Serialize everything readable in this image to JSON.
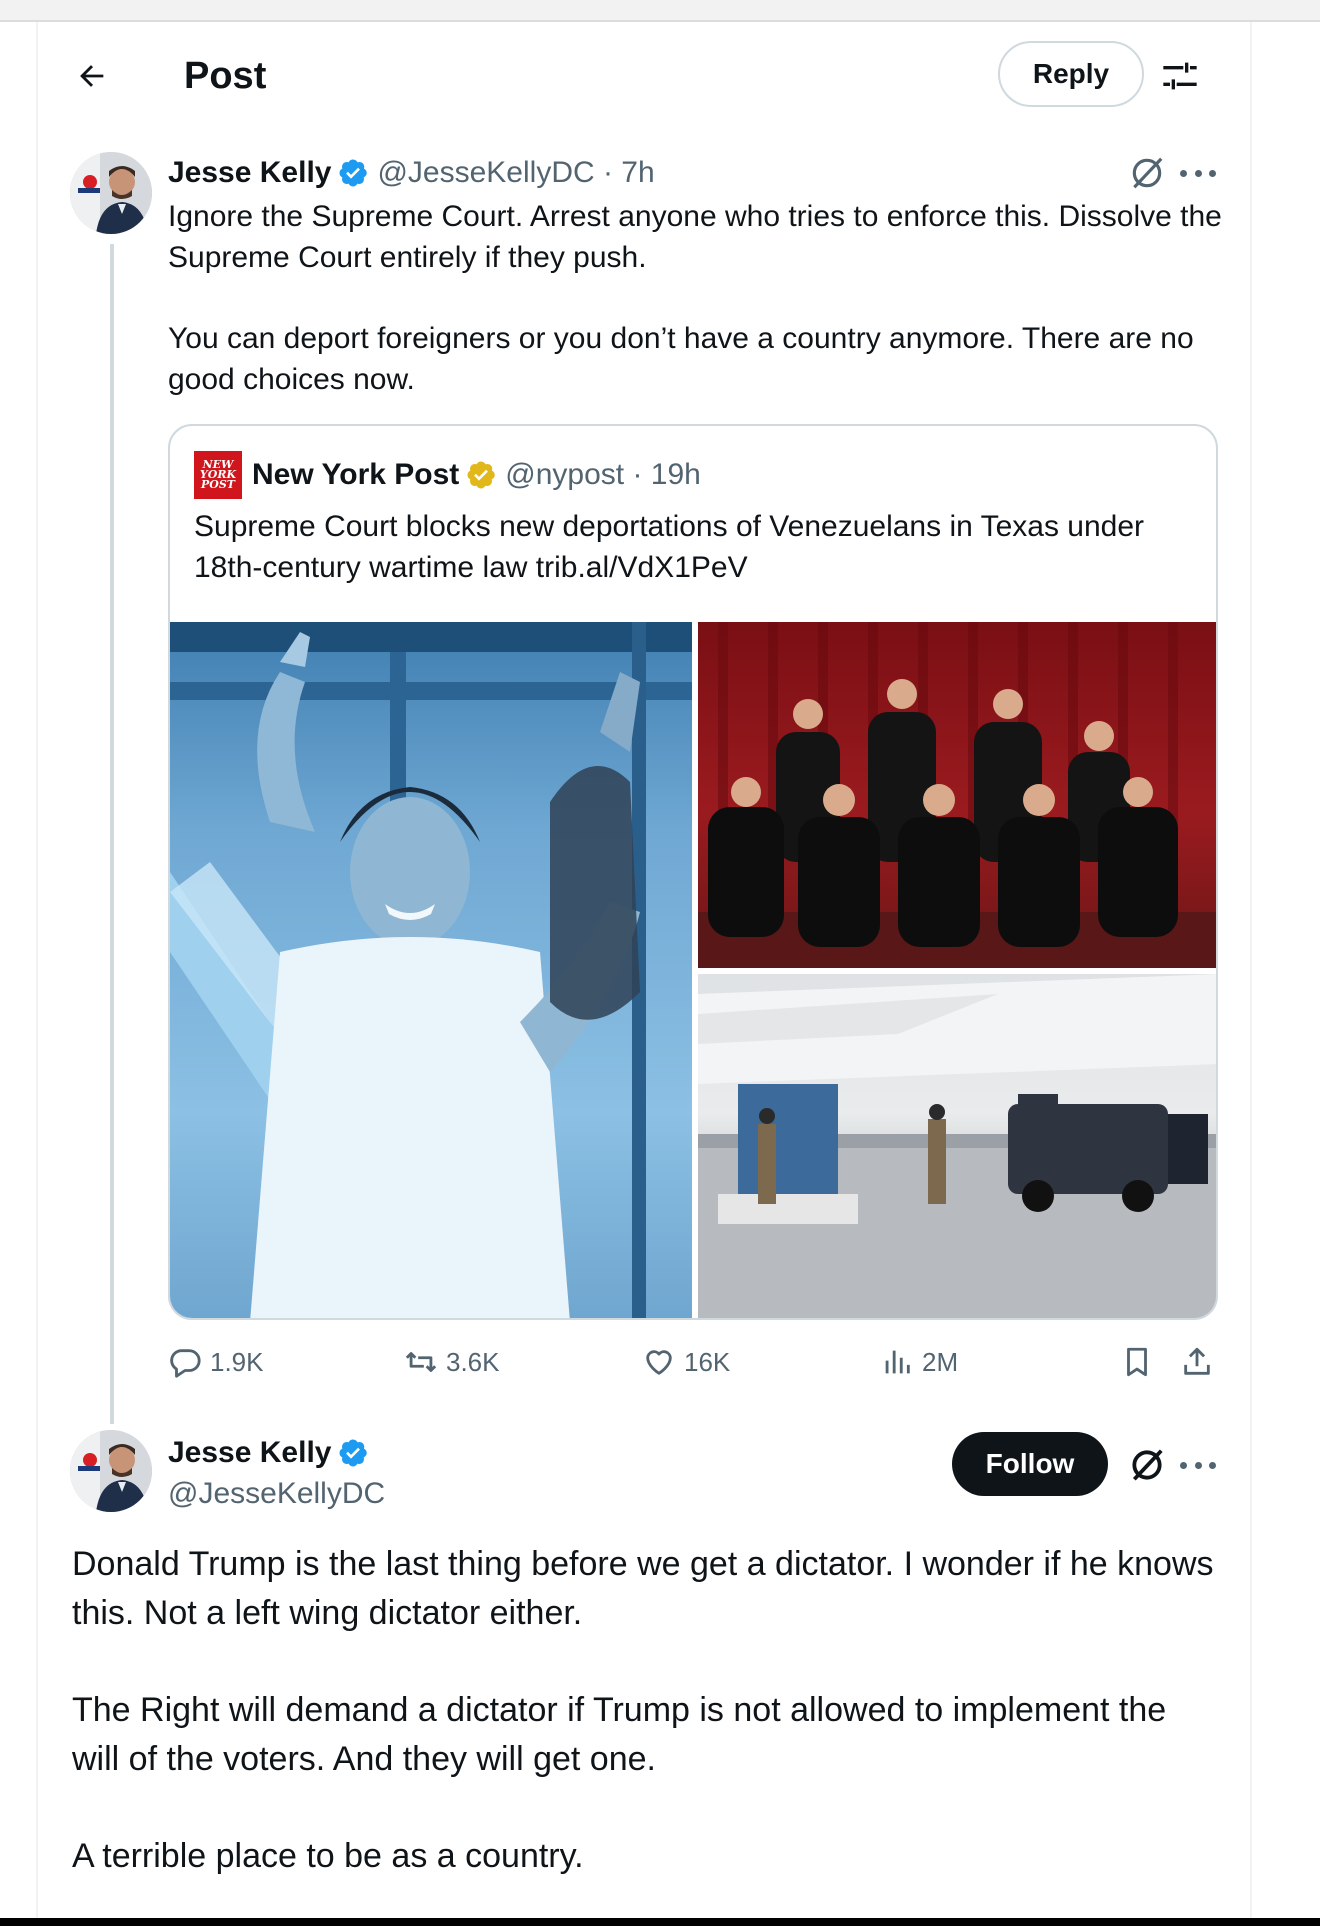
{
  "header": {
    "title": "Post",
    "reply_label": "Reply"
  },
  "tweet1": {
    "name": "Jesse Kelly",
    "handle_time": "@JesseKellyDC · 7h",
    "paragraphs": [
      "Ignore the Supreme Court. Arrest anyone who tries to enforce this. Dissolve the Supreme Court entirely if they push.",
      "You can deport foreigners or you don’t have a country anymore. There are no good choices now."
    ],
    "quote": {
      "logo_text": [
        "NEW",
        "YORK",
        "POST"
      ],
      "name": "New York Post",
      "handle_time": "@nypost · 19h",
      "text": "Supreme Court blocks new deportations of Venezuelans in Texas under 18th-century wartime law trib.al/VdX1PeV"
    },
    "stats": {
      "replies": "1.9K",
      "reposts": "3.6K",
      "likes": "16K",
      "views": "2M"
    }
  },
  "tweet2": {
    "name": "Jesse Kelly",
    "handle": "@JesseKellyDC",
    "follow_label": "Follow",
    "paragraphs": [
      "Donald Trump is the last thing before we get a dictator. I wonder if he knows this. Not a left wing dictator either.",
      "The Right will demand a dictator if Trump is not allowed to implement the will of the voters. And they will get one.",
      "A terrible place to be as a country."
    ]
  },
  "colors": {
    "verified_blue": "#1d9bf0",
    "verified_gold": "#e2b719",
    "secondary_text": "#536471",
    "border": "#cfd9de",
    "nypost_red": "#d0151c"
  },
  "icons": [
    "back-arrow-icon",
    "filter-icon",
    "verified-badge-icon",
    "grok-icon",
    "more-icon",
    "reply-icon",
    "repost-icon",
    "like-icon",
    "views-icon",
    "bookmark-icon",
    "share-icon"
  ]
}
